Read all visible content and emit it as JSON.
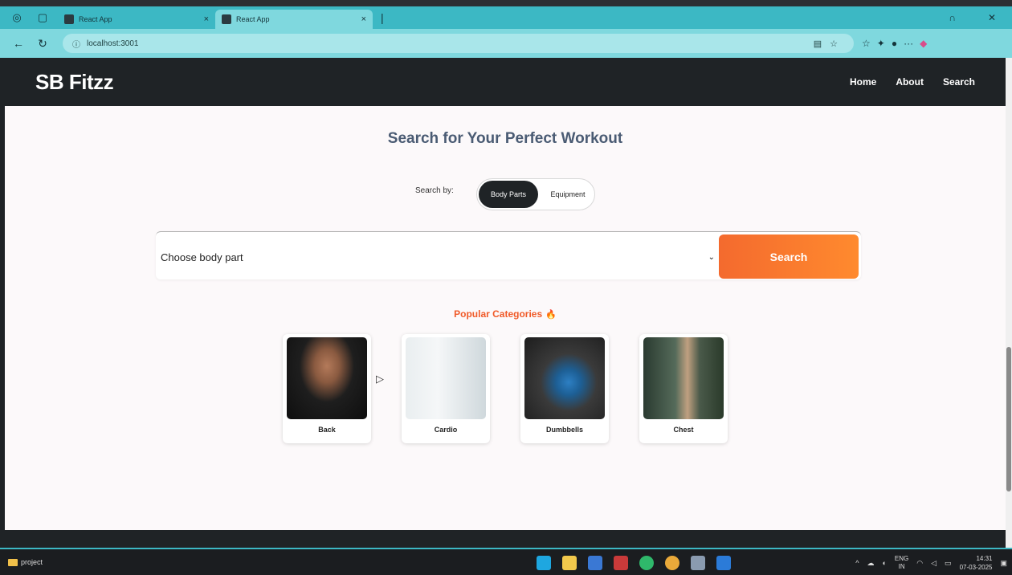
{
  "browser": {
    "tabs": [
      {
        "title": "React App",
        "close": "×"
      },
      {
        "title": "React App",
        "close": "×"
      }
    ],
    "new_tab": "|",
    "url": "localhost:3001",
    "toolbar_more": "···"
  },
  "app": {
    "brand": "SB Fitzz",
    "nav": [
      "Home",
      "About",
      "Search"
    ]
  },
  "search": {
    "heading": "Search for Your Perfect Workout",
    "search_by_label": "Search by:",
    "toggle_options": [
      "Body Parts",
      "Equipment"
    ],
    "select_value": "Choose body part",
    "button_label": "Search"
  },
  "popular": {
    "heading": "Popular Categories",
    "categories": [
      {
        "label": "Back"
      },
      {
        "label": "Cardio"
      },
      {
        "label": "Dumbbells"
      },
      {
        "label": "Chest"
      }
    ]
  },
  "taskbar": {
    "folder_label": "project",
    "lang_top": "ENG",
    "lang_bottom": "IN",
    "time": "14:31",
    "date": "07-03-2025"
  }
}
